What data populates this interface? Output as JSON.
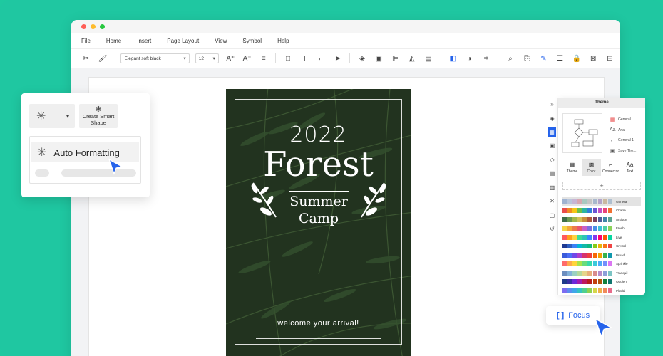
{
  "menu": [
    "File",
    "Home",
    "Insert",
    "Page Layout",
    "View",
    "Symbol",
    "Help"
  ],
  "toolbar": {
    "font": "Elegant soft black",
    "size": "12"
  },
  "poster": {
    "year": "2022",
    "title": "Forest",
    "subtitle_line1": "Summer",
    "subtitle_line2": "Camp",
    "welcome": "welcome your arrival!"
  },
  "float_card": {
    "create_smart_shape_line1": "Create Smart",
    "create_smart_shape_line2": "Shape",
    "auto_formatting": "Auto Formatting"
  },
  "theme_panel": {
    "title": "Theme",
    "options": [
      "General",
      "Arial",
      "General 1",
      "Save The..."
    ],
    "tabs": [
      "Theme",
      "Color",
      "Connector",
      "Text"
    ],
    "active_tab": "Color",
    "add_label": "+",
    "palettes": [
      {
        "name": "General",
        "colors": [
          "#9fb3d1",
          "#b9c6db",
          "#c7b5d4",
          "#d8a7b1",
          "#a9c9c0",
          "#c5c5c5",
          "#a8b8cc",
          "#b3a4c8",
          "#c9b8a0",
          "#aebfcf"
        ]
      },
      {
        "name": "Charm",
        "colors": [
          "#e84d4d",
          "#f08a24",
          "#f5c518",
          "#6cc04a",
          "#2bb3a3",
          "#2f7fd8",
          "#6b54d3",
          "#c44fc4",
          "#e8437a",
          "#f07030"
        ]
      },
      {
        "name": "Antique",
        "colors": [
          "#3f6e4a",
          "#6a9a52",
          "#a3b84b",
          "#d4c05a",
          "#c98f3e",
          "#b3573a",
          "#7a3f5e",
          "#4f5c9a",
          "#3f86a8",
          "#5aa38f"
        ]
      },
      {
        "name": "Fresh",
        "colors": [
          "#f5d547",
          "#f2a93b",
          "#ec7b4a",
          "#e8566d",
          "#c85fc9",
          "#7b6ee0",
          "#4a8fe8",
          "#3fbfd9",
          "#4fd1a5",
          "#8bd35a"
        ]
      },
      {
        "name": "Live",
        "colors": [
          "#ff5a5f",
          "#ff9f1c",
          "#ffd23f",
          "#3ddc97",
          "#2ec4b6",
          "#3a86ff",
          "#8338ec",
          "#ff006e",
          "#fb5607",
          "#06d6a0"
        ]
      },
      {
        "name": "Crystal",
        "colors": [
          "#1f3a93",
          "#2e5fc2",
          "#3b82f6",
          "#06b6d4",
          "#14b8a6",
          "#10b981",
          "#84cc16",
          "#eab308",
          "#f97316",
          "#ef4444"
        ]
      },
      {
        "name": "Broad",
        "colors": [
          "#3b5bdb",
          "#4c6ef5",
          "#7048e8",
          "#ae3ec9",
          "#d6336c",
          "#f03e3e",
          "#f76707",
          "#f59f00",
          "#37b24d",
          "#1098ad"
        ]
      },
      {
        "name": "Sprinkle",
        "colors": [
          "#ff6b6b",
          "#ffa94d",
          "#ffd43b",
          "#a9e34b",
          "#69db7c",
          "#38d9a9",
          "#3bc9db",
          "#4dabf7",
          "#748ffc",
          "#da77f2"
        ]
      },
      {
        "name": "Tranquil",
        "colors": [
          "#6c8ebf",
          "#82b1d9",
          "#9ad0c2",
          "#b5d99c",
          "#e6d58a",
          "#e8b07a",
          "#d98c8c",
          "#b58cc9",
          "#8ca0d9",
          "#7cc4c4"
        ]
      },
      {
        "name": "Opulent",
        "colors": [
          "#1e3a8a",
          "#3730a3",
          "#6d28d9",
          "#a21caf",
          "#be185d",
          "#b91c1c",
          "#c2410c",
          "#b45309",
          "#15803d",
          "#0f766e"
        ]
      },
      {
        "name": "Placid",
        "colors": [
          "#7c6cf0",
          "#5b8def",
          "#3fa7e8",
          "#36c2c2",
          "#4fcf8f",
          "#8fd14f",
          "#d6d64a",
          "#f0b14a",
          "#f08a5b",
          "#e86a8a"
        ]
      }
    ]
  },
  "focus": {
    "label": "Focus"
  },
  "colors": {
    "background": "#1fc7a1",
    "accent": "#2563eb"
  }
}
